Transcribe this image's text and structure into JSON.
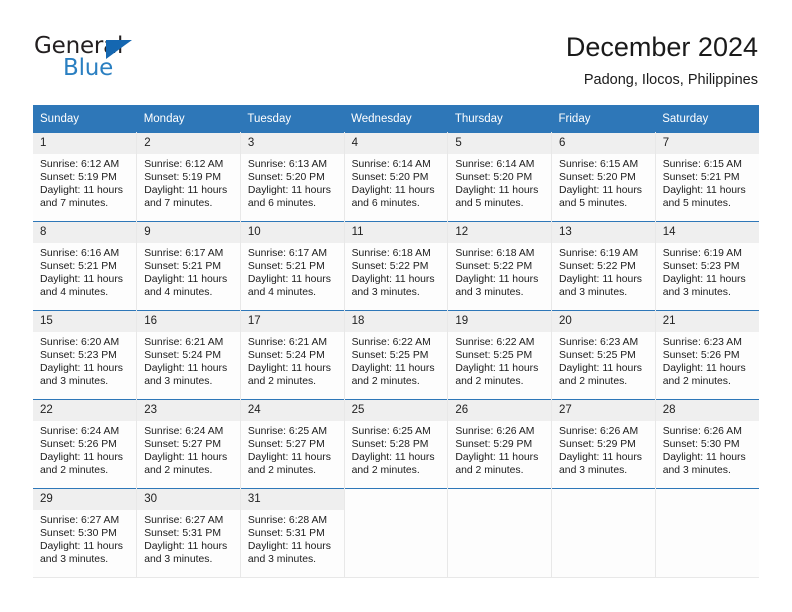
{
  "brand": {
    "name_top": "General",
    "name_bottom": "Blue",
    "triangle_color": "#1567b1",
    "blue_text_color": "#2a7fc1"
  },
  "header": {
    "title": "December 2024",
    "subtitle": "Padong, Ilocos, Philippines"
  },
  "theme": {
    "header_bg": "#2e77b8",
    "header_text": "#ffffff",
    "daynum_bg": "#efefef",
    "cell_bg": "#fdfdfd",
    "row_border": "#2e77b8"
  },
  "calendar": {
    "weekday_headers": [
      "Sunday",
      "Monday",
      "Tuesday",
      "Wednesday",
      "Thursday",
      "Friday",
      "Saturday"
    ],
    "weeks": [
      [
        {
          "day": "1",
          "sunrise": "Sunrise: 6:12 AM",
          "sunset": "Sunset: 5:19 PM",
          "daylight_line1": "Daylight: 11 hours",
          "daylight_line2": "and 7 minutes."
        },
        {
          "day": "2",
          "sunrise": "Sunrise: 6:12 AM",
          "sunset": "Sunset: 5:19 PM",
          "daylight_line1": "Daylight: 11 hours",
          "daylight_line2": "and 7 minutes."
        },
        {
          "day": "3",
          "sunrise": "Sunrise: 6:13 AM",
          "sunset": "Sunset: 5:20 PM",
          "daylight_line1": "Daylight: 11 hours",
          "daylight_line2": "and 6 minutes."
        },
        {
          "day": "4",
          "sunrise": "Sunrise: 6:14 AM",
          "sunset": "Sunset: 5:20 PM",
          "daylight_line1": "Daylight: 11 hours",
          "daylight_line2": "and 6 minutes."
        },
        {
          "day": "5",
          "sunrise": "Sunrise: 6:14 AM",
          "sunset": "Sunset: 5:20 PM",
          "daylight_line1": "Daylight: 11 hours",
          "daylight_line2": "and 5 minutes."
        },
        {
          "day": "6",
          "sunrise": "Sunrise: 6:15 AM",
          "sunset": "Sunset: 5:20 PM",
          "daylight_line1": "Daylight: 11 hours",
          "daylight_line2": "and 5 minutes."
        },
        {
          "day": "7",
          "sunrise": "Sunrise: 6:15 AM",
          "sunset": "Sunset: 5:21 PM",
          "daylight_line1": "Daylight: 11 hours",
          "daylight_line2": "and 5 minutes."
        }
      ],
      [
        {
          "day": "8",
          "sunrise": "Sunrise: 6:16 AM",
          "sunset": "Sunset: 5:21 PM",
          "daylight_line1": "Daylight: 11 hours",
          "daylight_line2": "and 4 minutes."
        },
        {
          "day": "9",
          "sunrise": "Sunrise: 6:17 AM",
          "sunset": "Sunset: 5:21 PM",
          "daylight_line1": "Daylight: 11 hours",
          "daylight_line2": "and 4 minutes."
        },
        {
          "day": "10",
          "sunrise": "Sunrise: 6:17 AM",
          "sunset": "Sunset: 5:21 PM",
          "daylight_line1": "Daylight: 11 hours",
          "daylight_line2": "and 4 minutes."
        },
        {
          "day": "11",
          "sunrise": "Sunrise: 6:18 AM",
          "sunset": "Sunset: 5:22 PM",
          "daylight_line1": "Daylight: 11 hours",
          "daylight_line2": "and 3 minutes."
        },
        {
          "day": "12",
          "sunrise": "Sunrise: 6:18 AM",
          "sunset": "Sunset: 5:22 PM",
          "daylight_line1": "Daylight: 11 hours",
          "daylight_line2": "and 3 minutes."
        },
        {
          "day": "13",
          "sunrise": "Sunrise: 6:19 AM",
          "sunset": "Sunset: 5:22 PM",
          "daylight_line1": "Daylight: 11 hours",
          "daylight_line2": "and 3 minutes."
        },
        {
          "day": "14",
          "sunrise": "Sunrise: 6:19 AM",
          "sunset": "Sunset: 5:23 PM",
          "daylight_line1": "Daylight: 11 hours",
          "daylight_line2": "and 3 minutes."
        }
      ],
      [
        {
          "day": "15",
          "sunrise": "Sunrise: 6:20 AM",
          "sunset": "Sunset: 5:23 PM",
          "daylight_line1": "Daylight: 11 hours",
          "daylight_line2": "and 3 minutes."
        },
        {
          "day": "16",
          "sunrise": "Sunrise: 6:21 AM",
          "sunset": "Sunset: 5:24 PM",
          "daylight_line1": "Daylight: 11 hours",
          "daylight_line2": "and 3 minutes."
        },
        {
          "day": "17",
          "sunrise": "Sunrise: 6:21 AM",
          "sunset": "Sunset: 5:24 PM",
          "daylight_line1": "Daylight: 11 hours",
          "daylight_line2": "and 2 minutes."
        },
        {
          "day": "18",
          "sunrise": "Sunrise: 6:22 AM",
          "sunset": "Sunset: 5:25 PM",
          "daylight_line1": "Daylight: 11 hours",
          "daylight_line2": "and 2 minutes."
        },
        {
          "day": "19",
          "sunrise": "Sunrise: 6:22 AM",
          "sunset": "Sunset: 5:25 PM",
          "daylight_line1": "Daylight: 11 hours",
          "daylight_line2": "and 2 minutes."
        },
        {
          "day": "20",
          "sunrise": "Sunrise: 6:23 AM",
          "sunset": "Sunset: 5:25 PM",
          "daylight_line1": "Daylight: 11 hours",
          "daylight_line2": "and 2 minutes."
        },
        {
          "day": "21",
          "sunrise": "Sunrise: 6:23 AM",
          "sunset": "Sunset: 5:26 PM",
          "daylight_line1": "Daylight: 11 hours",
          "daylight_line2": "and 2 minutes."
        }
      ],
      [
        {
          "day": "22",
          "sunrise": "Sunrise: 6:24 AM",
          "sunset": "Sunset: 5:26 PM",
          "daylight_line1": "Daylight: 11 hours",
          "daylight_line2": "and 2 minutes."
        },
        {
          "day": "23",
          "sunrise": "Sunrise: 6:24 AM",
          "sunset": "Sunset: 5:27 PM",
          "daylight_line1": "Daylight: 11 hours",
          "daylight_line2": "and 2 minutes."
        },
        {
          "day": "24",
          "sunrise": "Sunrise: 6:25 AM",
          "sunset": "Sunset: 5:27 PM",
          "daylight_line1": "Daylight: 11 hours",
          "daylight_line2": "and 2 minutes."
        },
        {
          "day": "25",
          "sunrise": "Sunrise: 6:25 AM",
          "sunset": "Sunset: 5:28 PM",
          "daylight_line1": "Daylight: 11 hours",
          "daylight_line2": "and 2 minutes."
        },
        {
          "day": "26",
          "sunrise": "Sunrise: 6:26 AM",
          "sunset": "Sunset: 5:29 PM",
          "daylight_line1": "Daylight: 11 hours",
          "daylight_line2": "and 2 minutes."
        },
        {
          "day": "27",
          "sunrise": "Sunrise: 6:26 AM",
          "sunset": "Sunset: 5:29 PM",
          "daylight_line1": "Daylight: 11 hours",
          "daylight_line2": "and 3 minutes."
        },
        {
          "day": "28",
          "sunrise": "Sunrise: 6:26 AM",
          "sunset": "Sunset: 5:30 PM",
          "daylight_line1": "Daylight: 11 hours",
          "daylight_line2": "and 3 minutes."
        }
      ],
      [
        {
          "day": "29",
          "sunrise": "Sunrise: 6:27 AM",
          "sunset": "Sunset: 5:30 PM",
          "daylight_line1": "Daylight: 11 hours",
          "daylight_line2": "and 3 minutes."
        },
        {
          "day": "30",
          "sunrise": "Sunrise: 6:27 AM",
          "sunset": "Sunset: 5:31 PM",
          "daylight_line1": "Daylight: 11 hours",
          "daylight_line2": "and 3 minutes."
        },
        {
          "day": "31",
          "sunrise": "Sunrise: 6:28 AM",
          "sunset": "Sunset: 5:31 PM",
          "daylight_line1": "Daylight: 11 hours",
          "daylight_line2": "and 3 minutes."
        },
        {
          "day": "",
          "sunrise": "",
          "sunset": "",
          "daylight_line1": "",
          "daylight_line2": ""
        },
        {
          "day": "",
          "sunrise": "",
          "sunset": "",
          "daylight_line1": "",
          "daylight_line2": ""
        },
        {
          "day": "",
          "sunrise": "",
          "sunset": "",
          "daylight_line1": "",
          "daylight_line2": ""
        },
        {
          "day": "",
          "sunrise": "",
          "sunset": "",
          "daylight_line1": "",
          "daylight_line2": ""
        }
      ]
    ]
  }
}
